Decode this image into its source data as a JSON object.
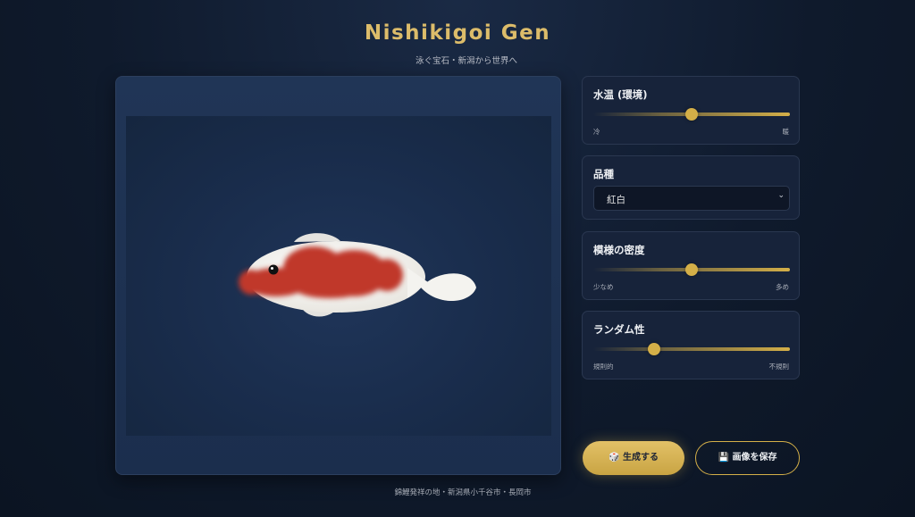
{
  "header": {
    "title": "Nishikigoi Gen",
    "subtitle": "泳ぐ宝石・新潟から世界へ"
  },
  "canvas": {
    "koi_colors": {
      "body": "#f4f3ef",
      "pattern": "#c0392b",
      "fins": "#f1f0ec",
      "water": "#1b2e4d"
    }
  },
  "controls": {
    "temperature": {
      "label": "水温 (環境)",
      "min_label": "冷",
      "max_label": "暖",
      "value": 0.5
    },
    "variety": {
      "label": "品種",
      "selected": "紅白"
    },
    "density": {
      "label": "模様の密度",
      "min_label": "少なめ",
      "max_label": "多め",
      "value": 0.5
    },
    "randomness": {
      "label": "ランダム性",
      "min_label": "規則的",
      "max_label": "不規則",
      "value": 0.3
    }
  },
  "actions": {
    "generate_icon": "dice-icon",
    "generate_label": "🎲 生成する",
    "save_icon": "floppy-disk-icon",
    "save_label": "💾 画像を保存"
  },
  "footer": {
    "text": "錦鯉発祥の地・新潟県小千谷市・長岡市"
  },
  "theme": {
    "accent": "#d4af48",
    "background": "#0f1a2c"
  }
}
